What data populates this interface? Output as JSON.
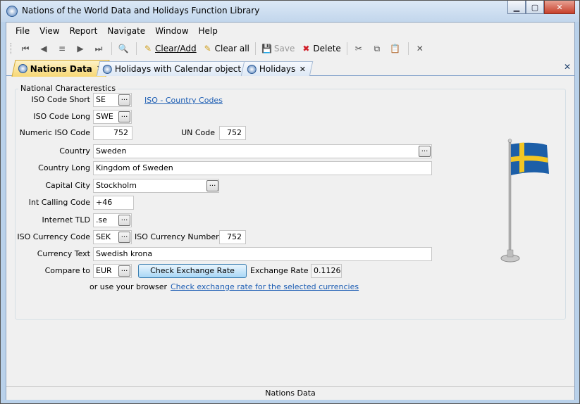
{
  "window": {
    "title": "Nations of the World Data and Holidays Function Library"
  },
  "menu": [
    "File",
    "View",
    "Report",
    "Navigate",
    "Window",
    "Help"
  ],
  "toolbar": {
    "clear_add": "Clear/Add",
    "clear_all": "Clear all",
    "save": "Save",
    "delete": "Delete"
  },
  "tabs": [
    {
      "label": "Nations Data",
      "active": true
    },
    {
      "label": "Holidays with Calendar object",
      "active": false
    },
    {
      "label": "Holidays",
      "active": false
    }
  ],
  "group_title": "National Characterestics",
  "form": {
    "iso_short_label": "ISO Code Short",
    "iso_short": "SE",
    "iso_long_label": "ISO Code Long",
    "iso_long": "SWE",
    "numeric_iso_label": "Numeric ISO Code",
    "numeric_iso": "752",
    "un_code_label": "UN Code",
    "un_code": "752",
    "country_label": "Country",
    "country": "Sweden",
    "country_long_label": "Country Long",
    "country_long": "Kingdom of Sweden",
    "capital_label": "Capital City",
    "capital": "Stockholm",
    "calling_label": "Int Calling Code",
    "calling": "+46",
    "tld_label": "Internet TLD",
    "tld": ".se",
    "currency_code_label": "ISO Currency Code",
    "currency_code": "SEK",
    "currency_number_label": "ISO Currency Number",
    "currency_number": "752",
    "currency_text_label": "Currency Text",
    "currency_text": "Swedish krona",
    "compare_label": "Compare to",
    "compare": "EUR",
    "check_rate_button": "Check Exchange Rate",
    "exchange_rate_label": "Exchange Rate",
    "exchange_rate": "0.1126",
    "browser_text": "or use your browser",
    "browser_link": "Check exchange rate for the selected currencies",
    "iso_link": "ISO - Country Codes",
    "ellipsis": "..."
  },
  "status": "Nations Data",
  "colors": {
    "flag_blue": "#1d5fa8",
    "flag_yellow": "#f3c623",
    "tab_active": "#f7d774"
  }
}
